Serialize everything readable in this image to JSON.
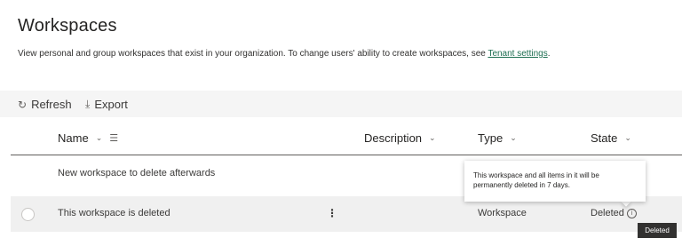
{
  "page": {
    "title": "Workspaces",
    "description": "View personal and group workspaces that exist in your organization. To change users' ability to create workspaces, see ",
    "link_text": "Tenant settings",
    "description_end": "."
  },
  "toolbar": {
    "refresh_icon": "refresh-icon",
    "refresh_label": "Refresh",
    "export_icon": "download-icon",
    "export_label": "Export"
  },
  "table": {
    "columns": {
      "name": "Name",
      "description": "Description",
      "type": "Type",
      "state": "State"
    },
    "rows": [
      {
        "name": "New workspace to delete afterwards",
        "type": "",
        "state": ""
      },
      {
        "name": "This workspace is deleted",
        "type": "Workspace",
        "state": "Deleted"
      }
    ]
  },
  "callout": {
    "text": "This workspace and all items in it will be permanently deleted in 7 days."
  },
  "tooltip": {
    "text": "Deleted"
  },
  "colors": {
    "link": "#1e6f52",
    "toolbar_bg": "#f5f5f5",
    "selected_row_bg": "#f0f0f0",
    "tooltip_bg": "#323130"
  }
}
